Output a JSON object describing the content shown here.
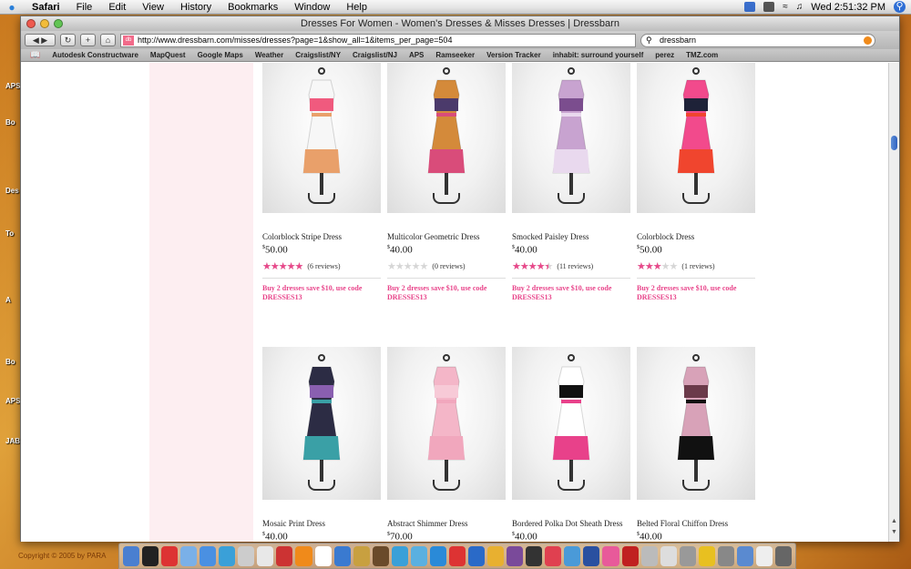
{
  "menubar": {
    "apple": "",
    "app_name": "Safari",
    "menus": [
      "File",
      "Edit",
      "View",
      "History",
      "Bookmarks",
      "Window",
      "Help"
    ],
    "clock": "Wed 2:51:32 PM"
  },
  "window": {
    "title": "Dresses For Women - Women's Dresses & Misses Dresses | Dressbarn",
    "url": "http://www.dressbarn.com/misses/dresses?page=1&show_all=1&items_per_page=504",
    "search_value": "dressbarn",
    "bookmarks": [
      "Autodesk Constructware",
      "MapQuest",
      "Google Maps",
      "Weather",
      "Craigslist/NY",
      "Craigslist/NJ",
      "APS",
      "Ramseeker",
      "Version Tracker",
      "inhabit: surround yourself",
      "perez",
      "TMZ.com"
    ]
  },
  "products": [
    {
      "name": "Colorblock Stripe Dress",
      "currency": "$",
      "price": "50.00",
      "rating": 5,
      "reviews": "(6 reviews)",
      "promo": "Buy 2 dresses save $10, use code DRESSES13",
      "colors": [
        "#f7f7f7",
        "#f05a7e",
        "#e9a06a"
      ]
    },
    {
      "name": "Multicolor Geometric Dress",
      "currency": "$",
      "price": "40.00",
      "rating": 0,
      "reviews": "(0 reviews)",
      "promo": "Buy 2 dresses save $10, use code DRESSES13",
      "colors": [
        "#d48a3a",
        "#4b3a6b",
        "#d94c7a"
      ]
    },
    {
      "name": "Smocked Paisley Dress",
      "currency": "$",
      "price": "40.00",
      "rating": 4.5,
      "reviews": "(11 reviews)",
      "promo": "Buy 2 dresses save $10, use code DRESSES13",
      "colors": [
        "#c8a3d0",
        "#7b4d8e",
        "#e9d9ee"
      ]
    },
    {
      "name": "Colorblock Dress",
      "currency": "$",
      "price": "50.00",
      "rating": 3,
      "reviews": "(1 reviews)",
      "promo": "Buy 2 dresses save $10, use code DRESSES13",
      "colors": [
        "#f24a8c",
        "#1e2238",
        "#f0452e"
      ]
    },
    {
      "name": "Mosaic Print Dress",
      "currency": "$",
      "price": "40.00",
      "colors": [
        "#2c2c44",
        "#8a5fb0",
        "#3aa0a6"
      ]
    },
    {
      "name": "Abstract Shimmer Dress",
      "currency": "$",
      "price": "70.00",
      "colors": [
        "#f4b6c8",
        "#f7cad7",
        "#f1a7bd"
      ]
    },
    {
      "name": "Bordered Polka Dot Sheath Dress",
      "currency": "$",
      "price": "40.00",
      "colors": [
        "#ffffff",
        "#111111",
        "#e8418a"
      ]
    },
    {
      "name": "Belted Floral Chiffon Dress",
      "currency": "$",
      "price": "40.00",
      "colors": [
        "#d8a2b8",
        "#6b3a4a",
        "#111111"
      ]
    }
  ],
  "desktop": {
    "labels": [
      "APS",
      "Bo",
      "Des",
      "To",
      "A",
      "Bo",
      "APS",
      "JAB"
    ],
    "footer": "Copyright © 2005 by PARA"
  }
}
